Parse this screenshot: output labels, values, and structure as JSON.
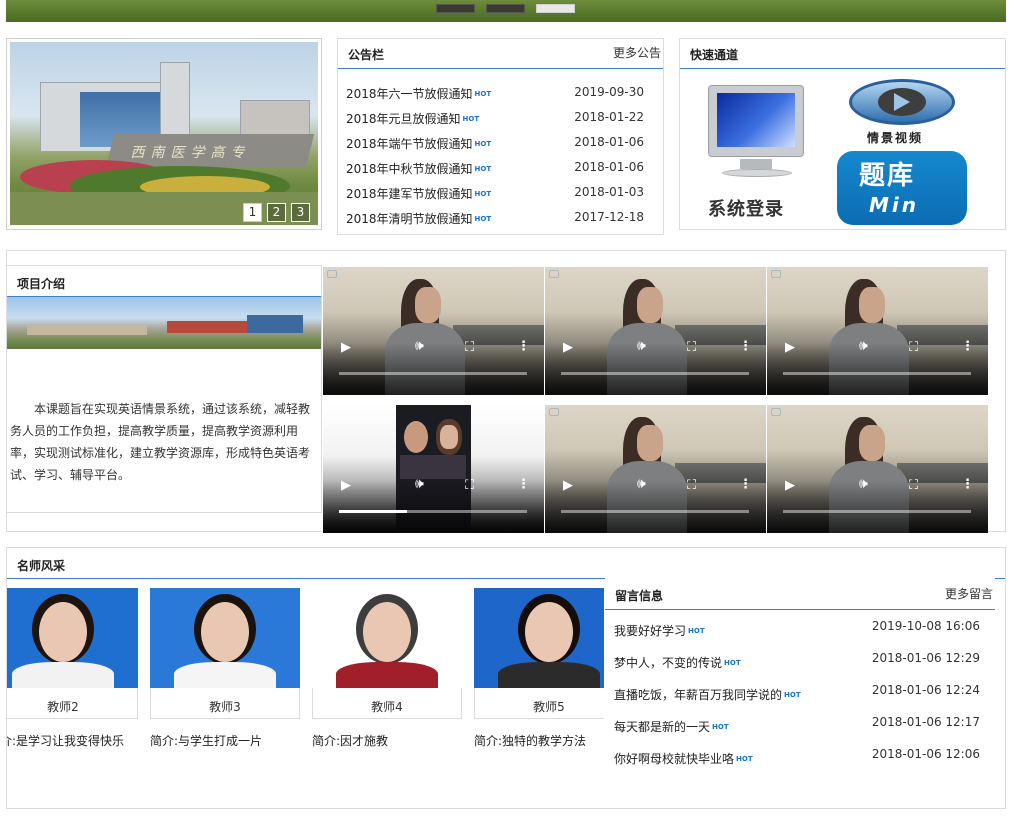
{
  "slider": {
    "sign_text": "西南医学高专",
    "pages": [
      "1",
      "2",
      "3"
    ],
    "active_page": 0
  },
  "notice": {
    "title": "公告栏",
    "more": "更多公告",
    "hot_label": "HOT",
    "items": [
      {
        "title": "2018年六一节放假通知",
        "date": "2019-09-30"
      },
      {
        "title": "2018年元旦放假通知",
        "date": "2018-01-22"
      },
      {
        "title": "2018年端午节放假通知",
        "date": "2018-01-06"
      },
      {
        "title": "2018年中秋节放假通知",
        "date": "2018-01-06"
      },
      {
        "title": "2018年建军节放假通知",
        "date": "2018-01-03"
      },
      {
        "title": "2018年清明节放假通知",
        "date": "2017-12-18"
      }
    ]
  },
  "quick": {
    "title": "快速通道",
    "login_label": "系统登录",
    "video_label": "情景视频",
    "bank_label": "题库",
    "bank_sub": "Min"
  },
  "project": {
    "title": "项目介绍",
    "text": "本课题旨在实现英语情景系统，通过该系统，减轻教务人员的工作负担，提高教学质量，提高教学资源利用率，实现测试标准化，建立教学资源库，形成特色英语考试、学习、辅导平台。"
  },
  "videos": {
    "count": 6,
    "progress": [
      0,
      0,
      0,
      0.36,
      0,
      0
    ]
  },
  "teachers": {
    "title": "名师风采",
    "items": [
      {
        "name": "教师2",
        "desc": "简介:是学习让我变得快乐"
      },
      {
        "name": "教师3",
        "desc": "简介:与学生打成一片"
      },
      {
        "name": "教师4",
        "desc": "简介:因才施教"
      },
      {
        "name": "教师5",
        "desc": "简介:独特的教学方法"
      }
    ]
  },
  "messages": {
    "title": "留言信息",
    "more": "更多留言",
    "hot_label": "HOT",
    "items": [
      {
        "title": "我要好好学习",
        "date": "2019-10-08 16:06"
      },
      {
        "title": "梦中人，不变的传说",
        "date": "2018-01-06 12:29"
      },
      {
        "title": "直播吃饭，年薪百万我同学说的",
        "date": "2018-01-06 12:24"
      },
      {
        "title": "每天都是新的一天",
        "date": "2018-01-06 12:17"
      },
      {
        "title": "你好啊母校就快毕业咯",
        "date": "2018-01-06 12:06"
      }
    ]
  },
  "colors": {
    "accent": "#3b7fc4",
    "hot": "#1a73c7",
    "border": "#dcdcdc"
  }
}
